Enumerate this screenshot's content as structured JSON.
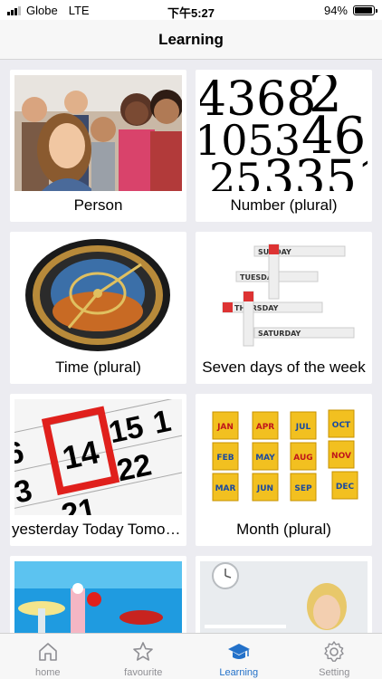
{
  "status_bar": {
    "carrier": "Globe",
    "network": "LTE",
    "time": "下午5:27",
    "battery": "94%",
    "battery_level": 0.94
  },
  "header": {
    "title": "Learning"
  },
  "categories": [
    {
      "label": "Person",
      "image": "group-of-people-photo"
    },
    {
      "label": "Number (plural)",
      "image": "numbers-typography-photo"
    },
    {
      "label": "Time (plural)",
      "image": "astronomical-clock-photo"
    },
    {
      "label": "Seven days of the week",
      "image": "weekday-crossword-photo"
    },
    {
      "label": "yesterday Today Tomorrow",
      "image": "calendar-14-photo"
    },
    {
      "label": "Month (plural)",
      "image": "month-cubes-photo"
    },
    {
      "label": "",
      "image": "cocktail-drinks-photo"
    },
    {
      "label": "",
      "image": "woman-on-phone-photo"
    }
  ],
  "tabs": [
    {
      "label": "home",
      "icon": "house-icon",
      "active": false
    },
    {
      "label": "favourite",
      "icon": "star-icon",
      "active": false
    },
    {
      "label": "Learning",
      "icon": "graduation-cap-icon",
      "active": true
    },
    {
      "label": "Setting",
      "icon": "gear-icon",
      "active": false
    }
  ],
  "colors": {
    "active_tab": "#2371c9",
    "inactive_tab": "#8e8e93",
    "content_bg": "#ececf1"
  }
}
